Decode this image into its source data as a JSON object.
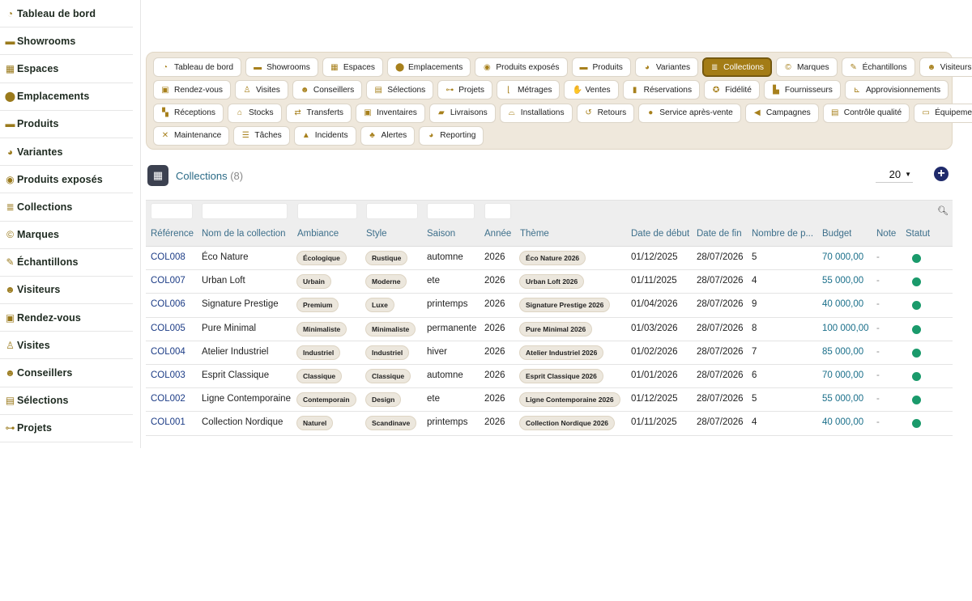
{
  "sidebar": {
    "items": [
      {
        "label": "Tableau de bord",
        "icon": "gauge-icon",
        "glyph": "◔"
      },
      {
        "label": "Showrooms",
        "icon": "sofa-icon",
        "glyph": "▬"
      },
      {
        "label": "Espaces",
        "icon": "grid-icon",
        "glyph": "▦"
      },
      {
        "label": "Emplacements",
        "icon": "map-pin-icon",
        "glyph": "⬤"
      },
      {
        "label": "Produits",
        "icon": "couch-icon",
        "glyph": "▬"
      },
      {
        "label": "Variantes",
        "icon": "palette-icon",
        "glyph": "◕"
      },
      {
        "label": "Produits exposés",
        "icon": "eye-icon",
        "glyph": "◉"
      },
      {
        "label": "Collections",
        "icon": "layers-icon",
        "glyph": "≣"
      },
      {
        "label": "Marques",
        "icon": "copyright-icon",
        "glyph": "©"
      },
      {
        "label": "Échantillons",
        "icon": "eyedropper-icon",
        "glyph": "✎"
      },
      {
        "label": "Visiteurs",
        "icon": "users-icon",
        "glyph": "☻"
      },
      {
        "label": "Rendez-vous",
        "icon": "calendar-check-icon",
        "glyph": "▣"
      },
      {
        "label": "Visites",
        "icon": "walking-icon",
        "glyph": "♙"
      },
      {
        "label": "Conseillers",
        "icon": "user-tie-icon",
        "glyph": "☻"
      },
      {
        "label": "Sélections",
        "icon": "clipboard-icon",
        "glyph": "▤"
      },
      {
        "label": "Projets",
        "icon": "diagram-icon",
        "glyph": "⊶"
      }
    ]
  },
  "nav": {
    "rows": [
      [
        {
          "label": "Tableau de bord",
          "icon": "gauge-icon",
          "glyph": "◔"
        },
        {
          "label": "Showrooms",
          "icon": "sofa-icon",
          "glyph": "▬"
        },
        {
          "label": "Espaces",
          "icon": "grid-icon",
          "glyph": "▦"
        },
        {
          "label": "Emplacements",
          "icon": "map-pin-icon",
          "glyph": "⬤"
        },
        {
          "label": "Produits exposés",
          "icon": "eye-icon",
          "glyph": "◉"
        },
        {
          "label": "Produits",
          "icon": "couch-icon",
          "glyph": "▬"
        },
        {
          "label": "Variantes",
          "icon": "palette-icon",
          "glyph": "◕"
        },
        {
          "label": "Collections",
          "icon": "layers-icon",
          "glyph": "≣",
          "active": true
        },
        {
          "label": "Marques",
          "icon": "copyright-icon",
          "glyph": "©"
        },
        {
          "label": "Échantillons",
          "icon": "eyedropper-icon",
          "glyph": "✎"
        },
        {
          "label": "Visiteurs",
          "icon": "users-icon",
          "glyph": "☻"
        }
      ],
      [
        {
          "label": "Rendez-vous",
          "icon": "calendar-check-icon",
          "glyph": "▣"
        },
        {
          "label": "Visites",
          "icon": "walking-icon",
          "glyph": "♙"
        },
        {
          "label": "Conseillers",
          "icon": "user-tie-icon",
          "glyph": "☻"
        },
        {
          "label": "Sélections",
          "icon": "clipboard-icon",
          "glyph": "▤"
        },
        {
          "label": "Projets",
          "icon": "diagram-icon",
          "glyph": "⊶"
        },
        {
          "label": "Métrages",
          "icon": "ruler-icon",
          "glyph": "⌊"
        },
        {
          "label": "Ventes",
          "icon": "handshake-icon",
          "glyph": "✋"
        },
        {
          "label": "Réservations",
          "icon": "bookmark-icon",
          "glyph": "▮"
        },
        {
          "label": "Fidélité",
          "icon": "award-icon",
          "glyph": "✪"
        },
        {
          "label": "Fournisseurs",
          "icon": "industry-icon",
          "glyph": "▙"
        },
        {
          "label": "Approvisionnements",
          "icon": "dolly-icon",
          "glyph": "⊾"
        }
      ],
      [
        {
          "label": "Réceptions",
          "icon": "truck-loading-icon",
          "glyph": "▚"
        },
        {
          "label": "Stocks",
          "icon": "warehouse-icon",
          "glyph": "⌂"
        },
        {
          "label": "Transferts",
          "icon": "exchange-icon",
          "glyph": "⇄"
        },
        {
          "label": "Inventaires",
          "icon": "clipboard-check-icon",
          "glyph": "▣"
        },
        {
          "label": "Livraisons",
          "icon": "truck-icon",
          "glyph": "▰"
        },
        {
          "label": "Installations",
          "icon": "tools-icon",
          "glyph": "⌓"
        },
        {
          "label": "Retours",
          "icon": "undo-icon",
          "glyph": "↺"
        },
        {
          "label": "Service après-vente",
          "icon": "comments-icon",
          "glyph": "●"
        },
        {
          "label": "Campagnes",
          "icon": "bullhorn-icon",
          "glyph": "◀"
        },
        {
          "label": "Contrôle qualité",
          "icon": "clipboard-list-icon",
          "glyph": "▤"
        },
        {
          "label": "Équipements",
          "icon": "desktop-icon",
          "glyph": "▭"
        }
      ],
      [
        {
          "label": "Maintenance",
          "icon": "wrench-icon",
          "glyph": "✕"
        },
        {
          "label": "Tâches",
          "icon": "tasks-icon",
          "glyph": "☰"
        },
        {
          "label": "Incidents",
          "icon": "warning-icon",
          "glyph": "▲"
        },
        {
          "label": "Alertes",
          "icon": "bell-icon",
          "glyph": "♣"
        },
        {
          "label": "Reporting",
          "icon": "chart-pie-icon",
          "glyph": "◕"
        }
      ]
    ]
  },
  "header": {
    "title": "Collections",
    "count": "(8)",
    "icon": "calendar-star-icon",
    "page_size": "20"
  },
  "table": {
    "columns": [
      "Référence",
      "Nom de la collection",
      "Ambiance",
      "Style",
      "Saison",
      "Année",
      "Thème",
      "Date de début",
      "Date de fin",
      "Nombre de p...",
      "Budget",
      "Note",
      "Statut"
    ],
    "rows": [
      {
        "ref": "COL008",
        "name": "Éco Nature",
        "ambiance": "Écologique",
        "style": "Rustique",
        "saison": "automne",
        "annee": "2026",
        "theme": "Éco Nature 2026",
        "debut": "01/12/2025",
        "fin": "28/07/2026",
        "nombre": "5",
        "budget": "70 000,00",
        "note": "-",
        "statut_color": "#1a9a6b"
      },
      {
        "ref": "COL007",
        "name": "Urban Loft",
        "ambiance": "Urbain",
        "style": "Moderne",
        "saison": "ete",
        "annee": "2026",
        "theme": "Urban Loft 2026",
        "debut": "01/11/2025",
        "fin": "28/07/2026",
        "nombre": "4",
        "budget": "55 000,00",
        "note": "-",
        "statut_color": "#1a9a6b"
      },
      {
        "ref": "COL006",
        "name": "Signature Prestige",
        "ambiance": "Premium",
        "style": "Luxe",
        "saison": "printemps",
        "annee": "2026",
        "theme": "Signature Prestige 2026",
        "debut": "01/04/2026",
        "fin": "28/07/2026",
        "nombre": "9",
        "budget": "40 000,00",
        "note": "-",
        "statut_color": "#1a9a6b"
      },
      {
        "ref": "COL005",
        "name": "Pure Minimal",
        "ambiance": "Minimaliste",
        "style": "Minimaliste",
        "saison": "permanente",
        "annee": "2026",
        "theme": "Pure Minimal 2026",
        "debut": "01/03/2026",
        "fin": "28/07/2026",
        "nombre": "8",
        "budget": "100 000,00",
        "note": "-",
        "statut_color": "#1a9a6b"
      },
      {
        "ref": "COL004",
        "name": "Atelier Industriel",
        "ambiance": "Industriel",
        "style": "Industriel",
        "saison": "hiver",
        "annee": "2026",
        "theme": "Atelier Industriel 2026",
        "debut": "01/02/2026",
        "fin": "28/07/2026",
        "nombre": "7",
        "budget": "85 000,00",
        "note": "-",
        "statut_color": "#1a9a6b"
      },
      {
        "ref": "COL003",
        "name": "Esprit Classique",
        "ambiance": "Classique",
        "style": "Classique",
        "saison": "automne",
        "annee": "2026",
        "theme": "Esprit Classique 2026",
        "debut": "01/01/2026",
        "fin": "28/07/2026",
        "nombre": "6",
        "budget": "70 000,00",
        "note": "-",
        "statut_color": "#1a9a6b"
      },
      {
        "ref": "COL002",
        "name": "Ligne Contemporaine",
        "ambiance": "Contemporain",
        "style": "Design",
        "saison": "ete",
        "annee": "2026",
        "theme": "Ligne Contemporaine 2026",
        "debut": "01/12/2025",
        "fin": "28/07/2026",
        "nombre": "5",
        "budget": "55 000,00",
        "note": "-",
        "statut_color": "#1a9a6b"
      },
      {
        "ref": "COL001",
        "name": "Collection Nordique",
        "ambiance": "Naturel",
        "style": "Scandinave",
        "saison": "printemps",
        "annee": "2026",
        "theme": "Collection Nordique 2026",
        "debut": "01/11/2025",
        "fin": "28/07/2026",
        "nombre": "4",
        "budget": "40 000,00",
        "note": "-",
        "statut_color": "#1a9a6b"
      }
    ]
  },
  "colors": {
    "accent": "#a37c16",
    "title": "#2a6a86",
    "ref": "#1c3c86",
    "add_button": "#1f2a6b",
    "status_active": "#1a9a6b"
  }
}
